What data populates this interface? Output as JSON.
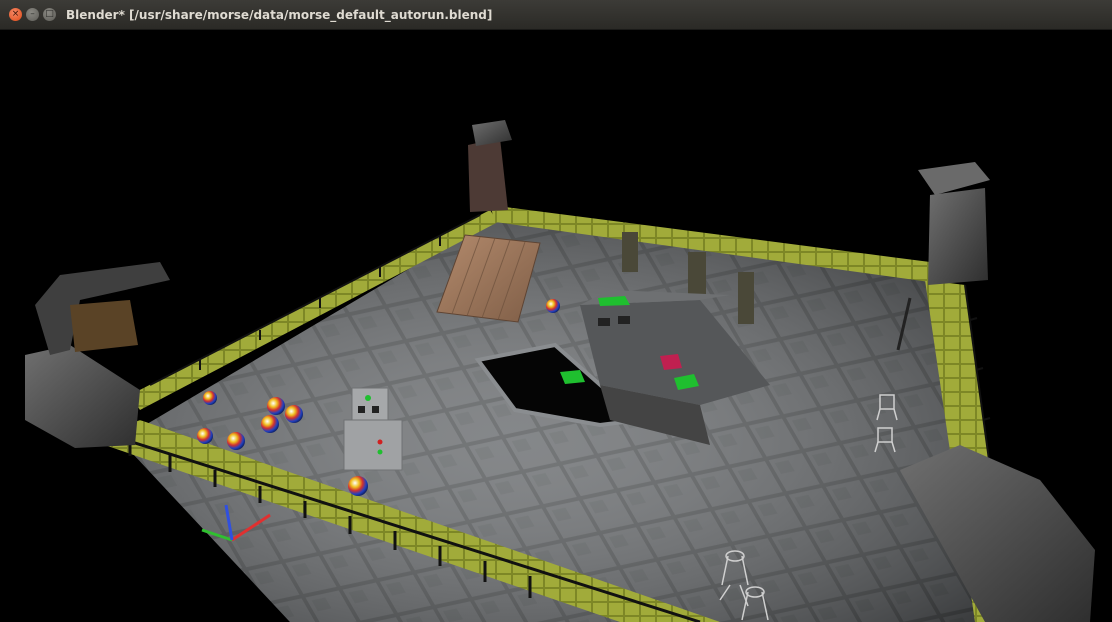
{
  "window": {
    "title": "Blender* [/usr/share/morse/data/morse_default_autorun.blend]",
    "buttons": {
      "close_glyph": "×",
      "minimize_glyph": "–",
      "maximize_glyph": "□"
    }
  },
  "viewport": {
    "description_icons": [
      "tiled-floor",
      "perimeter-wall",
      "stone-pillars",
      "wooden-ramp",
      "boxy-vehicle",
      "robot",
      "beach-balls",
      "chairs",
      "axis-gizmo"
    ],
    "colors": {
      "background": "#000000",
      "wall_top": "#8f9a2c",
      "floor": "#4a4c4e",
      "ramp": "#9a7356",
      "axis_x": "#e03030",
      "axis_y": "#30c030",
      "axis_z": "#3050e0"
    }
  }
}
